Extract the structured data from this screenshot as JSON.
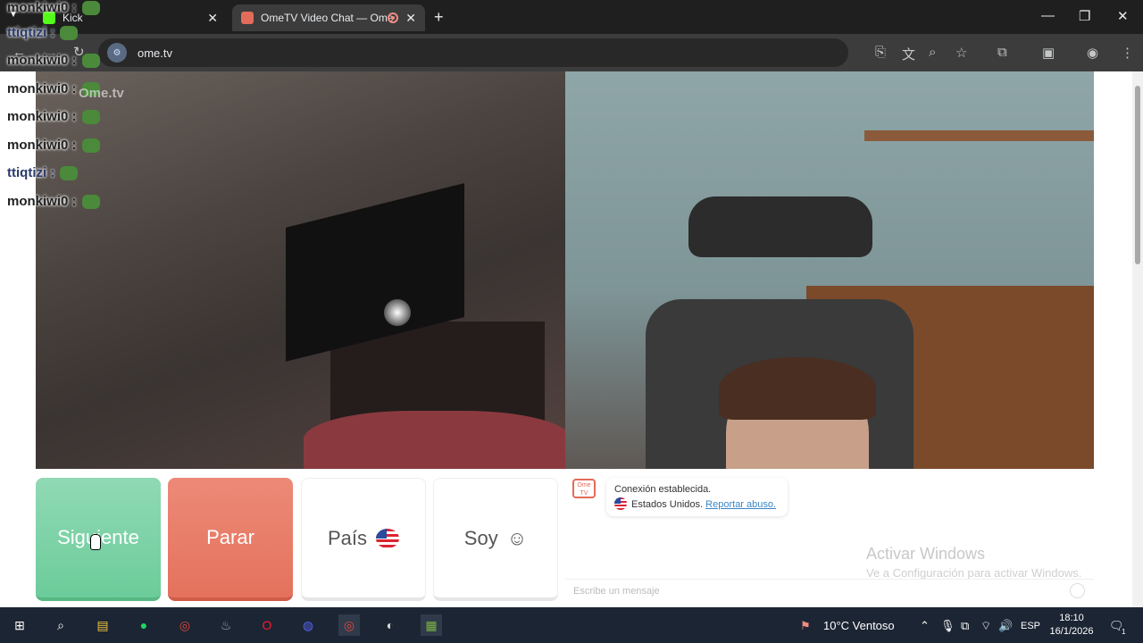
{
  "browser": {
    "tabs": [
      {
        "title": "Kick",
        "active": false
      },
      {
        "title": "OmeTV Video Chat — Ome",
        "active": true
      }
    ],
    "new_tab": "+",
    "url": "ome.tv"
  },
  "stream_chat": [
    {
      "user": "monkiwi0 :",
      "emote": "pepe"
    },
    {
      "user": "ttiqtizi :",
      "emote": "pepe"
    },
    {
      "user": "monkiwi0 :",
      "emote": "pepe"
    },
    {
      "user": "monkiwi0 :",
      "emote": "pepe"
    },
    {
      "user": "monkiwi0 :",
      "emote": "pepe"
    },
    {
      "user": "monkiwi0 :",
      "emote": "pepe"
    },
    {
      "user": "ttiqtizi :",
      "emote": "pepe"
    },
    {
      "user": "monkiwi0 :",
      "emote": "pepe"
    }
  ],
  "ome_logo": "Ome.tv",
  "controls": {
    "next": "Siguiente",
    "stop": "Parar",
    "country": "País",
    "gender": "Soy"
  },
  "chat": {
    "logo": "Ome TV",
    "status": "Conexión establecida.",
    "country": "Estados Unidos.",
    "report": "Reportar abuso.",
    "placeholder": "Escribe un mensaje"
  },
  "windows_watermark": {
    "title": "Activar Windows",
    "subtitle": "Ve a Configuración para activar Windows."
  },
  "taskbar": {
    "weather": "10°C  Ventoso",
    "language": "ESP",
    "time": "18:10",
    "date": "16/1/2026",
    "notification_count": "1"
  }
}
